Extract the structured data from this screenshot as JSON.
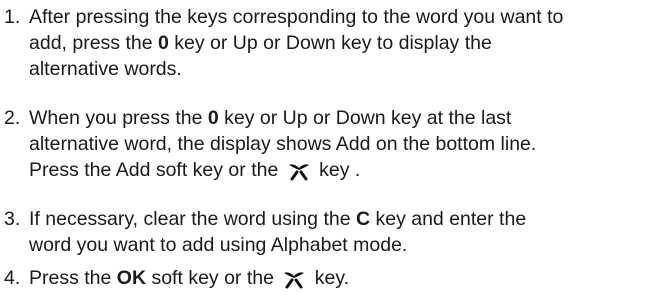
{
  "steps": [
    {
      "number": "1.",
      "lines": [
        [
          "After pressing the keys corresponding to the word you want to"
        ],
        [
          "add, press the ",
          "0",
          " key or Up or Down key to display the"
        ],
        [
          "alternative words."
        ]
      ]
    },
    {
      "number": "2.",
      "lines": [
        [
          "When you press the ",
          "0",
          " key or Up or Down key at the last"
        ],
        [
          "alternative word, the display shows Add on the bottom line."
        ],
        [
          "Press the Add soft key or the ",
          " key ."
        ]
      ]
    },
    {
      "number": "3.",
      "lines": [
        [
          "If necessary, clear the word using the ",
          "C",
          " key and enter the"
        ],
        [
          "word you want to add using Alphabet mode."
        ]
      ]
    },
    {
      "number": "4.",
      "lines": [
        [
          "Press the ",
          "OK",
          " soft key or  the ",
          " key."
        ]
      ]
    }
  ],
  "icons": {
    "select_key": "select-key-icon"
  }
}
